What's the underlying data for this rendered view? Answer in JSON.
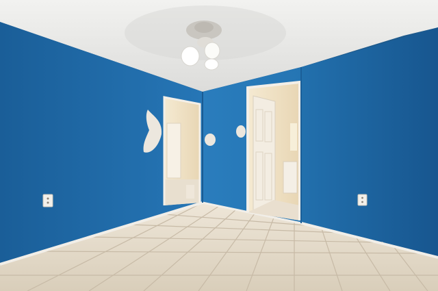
{
  "scene": {
    "subject": "empty-room-photo",
    "fixtures": [
      "ceiling-fan",
      "doorway-left",
      "doorway-right",
      "electrical-outlet-left",
      "electrical-outlet-right",
      "tile-floor"
    ]
  },
  "colors": {
    "ceiling": "#e9e9e7",
    "wall_blue": "#1f6aa8",
    "wall_blue_dark": "#174f82",
    "wall_blue_light": "#2a7fc0",
    "trim_white": "#f1eee8",
    "floor_tile": "#e6ddcf",
    "grout": "#c8bcaa",
    "doorway_interior": "#f0e3c8"
  }
}
